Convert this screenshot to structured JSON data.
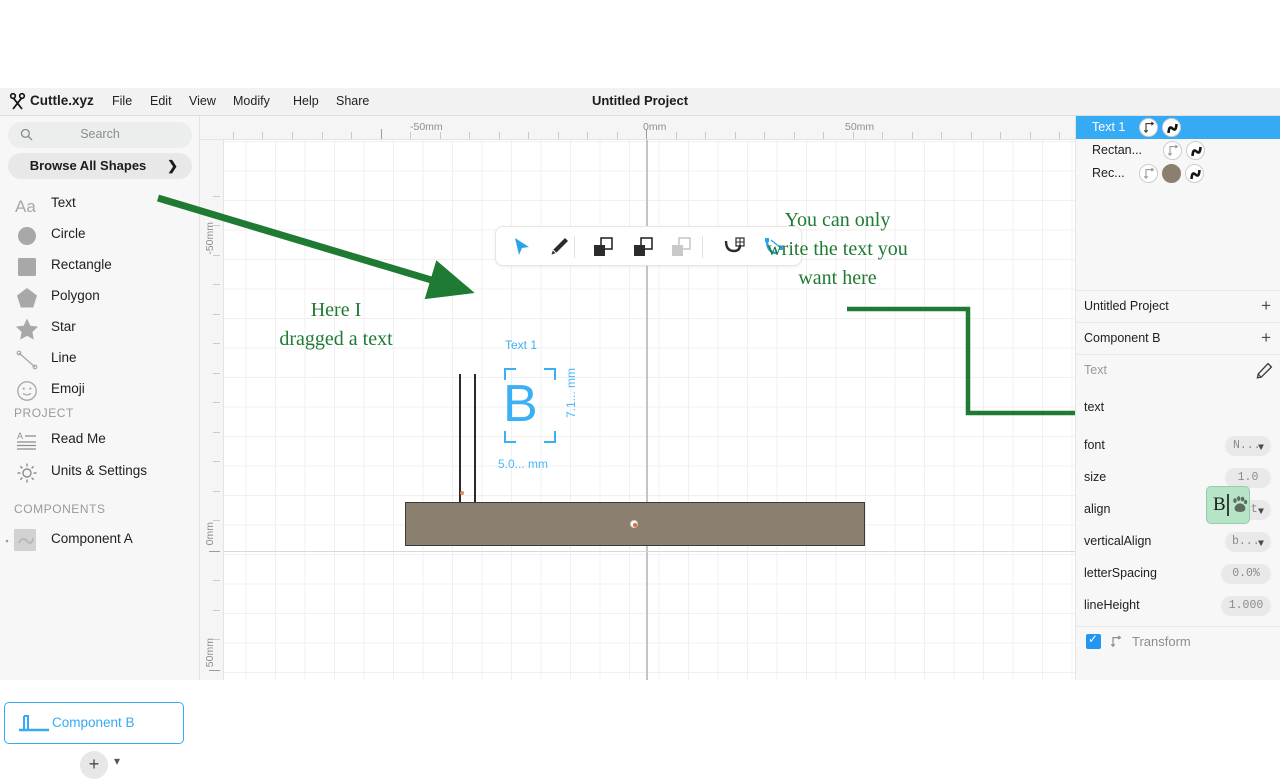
{
  "app": {
    "brand": "Cuttle.xyz",
    "logo_icon": "scissors-icon",
    "title": "Untitled Project",
    "menus": [
      "File",
      "Edit",
      "View",
      "Modify",
      "Help",
      "Share"
    ]
  },
  "sidebar": {
    "search": {
      "placeholder": "Search",
      "icon": "search-icon",
      "value": ""
    },
    "browse": {
      "label": "Browse All Shapes",
      "chevron": "chevron-right-icon"
    },
    "shapes": [
      {
        "label": "Text",
        "icon": "text-aa-icon"
      },
      {
        "label": "Circle",
        "icon": "circle-icon"
      },
      {
        "label": "Rectangle",
        "icon": "rectangle-icon"
      },
      {
        "label": "Polygon",
        "icon": "polygon-icon"
      },
      {
        "label": "Star",
        "icon": "star-icon"
      },
      {
        "label": "Line",
        "icon": "line-icon"
      },
      {
        "label": "Emoji",
        "icon": "emoji-smiley-icon"
      }
    ],
    "project_header": "PROJECT",
    "project_items": [
      {
        "label": "Read Me",
        "icon": "document-icon"
      },
      {
        "label": "Units & Settings",
        "icon": "gear-icon"
      }
    ],
    "components_header": "COMPONENTS",
    "components": [
      {
        "label": "Component A",
        "icon": "component-thumb-icon",
        "selected": false
      },
      {
        "label": "Component B",
        "icon": "component-thumb-icon",
        "selected": true
      }
    ],
    "add_button": {
      "icon": "plus-icon",
      "chevron": "chevron-down-icon"
    }
  },
  "canvas": {
    "ruler_h": [
      "-50mm",
      "0mm",
      "50mm"
    ],
    "ruler_v": [
      "-50mm",
      "0mm",
      "50mm"
    ],
    "toolbar": [
      {
        "icon": "select-arrow-icon",
        "active": true
      },
      {
        "icon": "pen-nib-icon",
        "active": false
      },
      {
        "icon": "boolean-union-icon",
        "active": false
      },
      {
        "icon": "boolean-subtract-icon",
        "active": false
      },
      {
        "icon": "boolean-intersect-icon",
        "active": false
      },
      {
        "icon": "snap-grid-icon",
        "active": false
      },
      {
        "icon": "path-edit-icon",
        "active": true
      }
    ],
    "selection": {
      "label": "Text 1",
      "glyph": "B",
      "width_label": "5.0... mm",
      "height_label": "7.1... mm"
    },
    "shape_color": "#8b8070"
  },
  "annotations": [
    {
      "id": "anno-drag-text",
      "lines": [
        "Here I",
        "dragged a text"
      ]
    },
    {
      "id": "anno-write-text",
      "lines": [
        "You can only",
        "write the text you",
        "want here"
      ]
    }
  ],
  "right_panel": {
    "layers": [
      {
        "name": "Text 1",
        "selected": true,
        "badges": [
          "transform-icon",
          "curve-icon"
        ]
      },
      {
        "name": "Rectan...",
        "selected": false,
        "badges": [
          "transform-icon",
          "curve-icon"
        ]
      },
      {
        "name": "Rec...",
        "selected": false,
        "badges": [
          "transform-icon",
          "fill-swatch-icon",
          "curve-icon"
        ]
      }
    ],
    "groups": [
      {
        "label": "Untitled Project",
        "add": "+"
      },
      {
        "label": "Component B",
        "add": "+"
      }
    ],
    "section": {
      "label": "Text",
      "icon": "pencil-icon"
    },
    "properties": [
      {
        "label": "text",
        "value": "B",
        "type": "text-input",
        "emoji": "paw-print-icon"
      },
      {
        "label": "font",
        "value": "N...",
        "type": "select"
      },
      {
        "label": "size",
        "value": "1.0",
        "type": "number"
      },
      {
        "label": "align",
        "value": "left",
        "type": "select"
      },
      {
        "label": "verticalAlign",
        "value": "b...",
        "type": "select"
      },
      {
        "label": "letterSpacing",
        "value": "0.0%",
        "type": "number"
      },
      {
        "label": "lineHeight",
        "value": "1.000",
        "type": "number"
      }
    ],
    "transform": {
      "label": "Transform",
      "checked": true,
      "icon": "transform-icon"
    }
  },
  "colors": {
    "accent": "#35aaf5",
    "annotation": "#1f7a33",
    "shape": "#8b8070",
    "input_bg": "#b5e5c6"
  }
}
